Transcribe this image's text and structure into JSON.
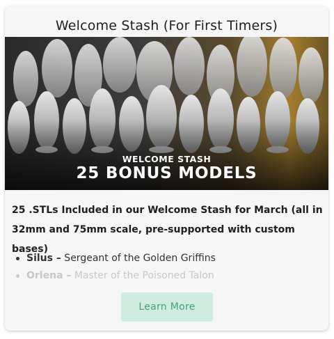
{
  "card": {
    "title": "Welcome Stash (For First Timers)",
    "hero": {
      "caption_small": "WELCOME STASH",
      "caption_big": "25 BONUS MODELS"
    },
    "headline": "25 .STLs Included in our Welcome Stash for March (all in 32mm and 75mm scale, pre-supported with custom bases)",
    "models": [
      {
        "name": "Silus –",
        "description": " Sergeant of the Golden Griffins"
      },
      {
        "name": "Orlena –",
        "description": " Master of the Poisoned Talon"
      }
    ],
    "cta_label": "Learn More"
  },
  "colors": {
    "card_bg": "#f6f6f6",
    "button_bg": "#cfece0",
    "button_text": "#4a9f79",
    "hero_accent": "#a47d2e"
  }
}
